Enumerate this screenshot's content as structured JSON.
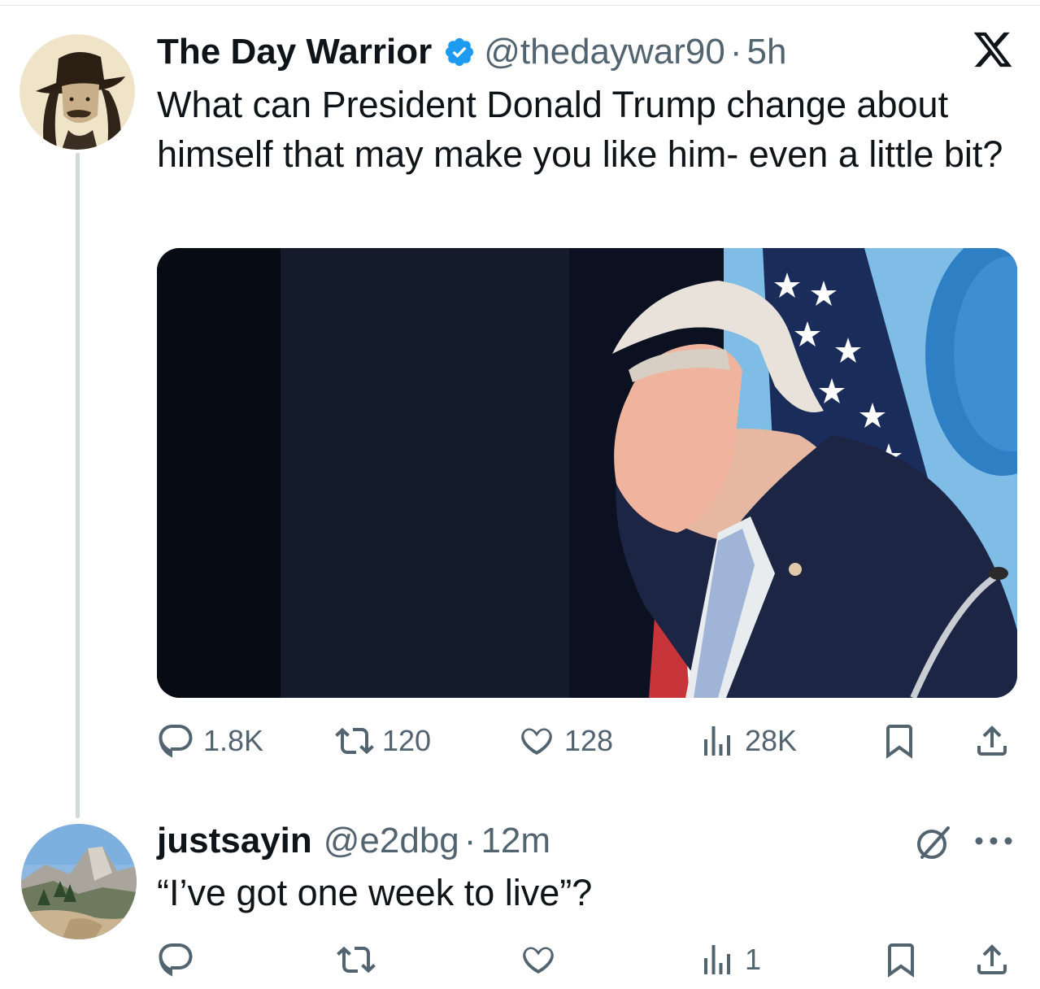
{
  "tweet": {
    "display_name": "The Day Warrior",
    "verified_icon": "verified-badge-icon",
    "handle": "@thedaywar90",
    "separator": "·",
    "time": "5h",
    "platform_icon": "x-logo-icon",
    "text": "What can President Donald Trump change about himself that may make you like him- even a little bit?",
    "media_icon": "photo",
    "stats": {
      "replies": "1.8K",
      "reposts": "120",
      "likes": "128",
      "views": "28K"
    }
  },
  "reply": {
    "display_name": "justsayin",
    "handle": "@e2dbg",
    "separator": "·",
    "time": "12m",
    "text": "“I’ve got one week to live”?",
    "stats": {
      "views": "1"
    }
  },
  "colors": {
    "text": "#0f1419",
    "secondary": "#536471",
    "verified": "#1d9bf0",
    "thread_line": "#cfd9de"
  }
}
